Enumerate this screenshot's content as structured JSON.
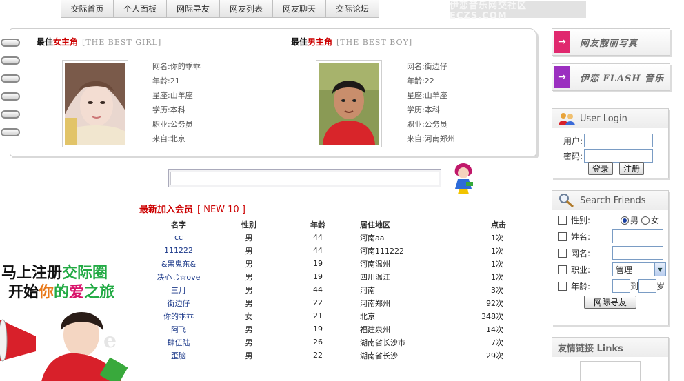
{
  "nav": {
    "tabs": [
      "交际首页",
      "个人面板",
      "网际寻友",
      "网友列表",
      "网友聊天",
      "交际论坛"
    ],
    "banner_text": "伊恋音乐网交社区 ECZS.COM"
  },
  "featured": {
    "girl": {
      "title_prefix": "最佳",
      "title_red": "女主角",
      "title_en": "[THE BEST GIRL]",
      "profile": [
        "网名:你的乖乖",
        "年龄:21",
        "星座:山羊座",
        "学历:本科",
        "职业:公务员",
        "来自:北京"
      ]
    },
    "boy": {
      "title_prefix": "最佳",
      "title_red": "男主角",
      "title_en": "[THE BEST BOY]",
      "profile": [
        "网名:街边仔",
        "年龄:22",
        "星座:山羊座",
        "学历:本科",
        "职业:公务员",
        "来自:河南郑州"
      ]
    }
  },
  "search": {
    "value": ""
  },
  "new_members": {
    "title": "最新加入会员",
    "count_label": "[ NEW 10 ]",
    "headers": [
      "名字",
      "性别",
      "年龄",
      "居住地区",
      "点击"
    ],
    "rows": [
      [
        "cc",
        "男",
        "44",
        "河南aa",
        "1次"
      ],
      [
        "111222",
        "男",
        "44",
        "河南111222",
        "1次"
      ],
      [
        "&黑鬼东&",
        "男",
        "19",
        "河南温州",
        "1次"
      ],
      [
        "决心じ☆ove",
        "男",
        "19",
        "四川温江",
        "1次"
      ],
      [
        "三月",
        "男",
        "44",
        "河南",
        "3次"
      ],
      [
        "街边仔",
        "男",
        "22",
        "河南郑州",
        "92次"
      ],
      [
        "你的乖乖",
        "女",
        "21",
        "北京",
        "348次"
      ],
      [
        "阿飞",
        "男",
        "19",
        "福建泉州",
        "14次"
      ],
      [
        "肆伍陆",
        "男",
        "26",
        "湖南省长沙市",
        "7次"
      ],
      [
        "歪脑",
        "男",
        "22",
        "湖南省长沙",
        "29次"
      ]
    ]
  },
  "promo": {
    "line1_a": "马上注册",
    "line1_b": "交际圈",
    "line2_a": "开始",
    "line2_b": "你",
    "line2_c": "的",
    "line2_d": "爱",
    "line2_e": "之旅"
  },
  "sidebar": {
    "btn1": "网友靓丽写真",
    "btn2": "伊恋 FLASH 音乐",
    "login": {
      "title": "User Login",
      "user_label": "用户:",
      "pass_label": "密码:",
      "login_btn": "登录",
      "register_btn": "注册"
    },
    "search_friends": {
      "title": "Search Friends",
      "gender_label": "性别:",
      "male": "男",
      "female": "女",
      "name_label": "姓名:",
      "nick_label": "网名:",
      "job_label": "职业:",
      "job_value": "管理",
      "age_label": "年龄:",
      "age_to": "到",
      "age_unit": "岁",
      "submit": "网际寻友"
    },
    "links": {
      "title": "友情链接 Links"
    }
  },
  "colors": {
    "accent_red": "#cc0000",
    "link_blue": "#1d3a8a",
    "pink_btn": "#e0286e",
    "purple_btn": "#9b2fc0"
  }
}
